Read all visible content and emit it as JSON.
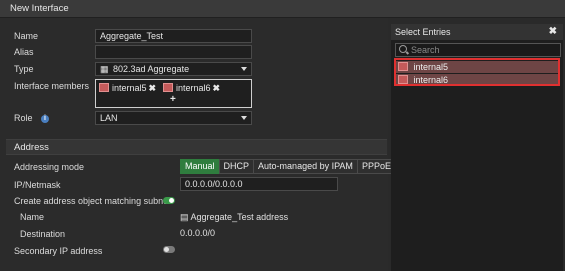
{
  "window": {
    "title": "New Interface"
  },
  "form": {
    "name": {
      "label": "Name",
      "value": "Aggregate_Test"
    },
    "alias": {
      "label": "Alias",
      "value": ""
    },
    "type": {
      "label": "Type",
      "value": "802.3ad Aggregate"
    },
    "members": {
      "label": "Interface members",
      "items": [
        "internal5",
        "internal6"
      ],
      "add_glyph": "+"
    },
    "role": {
      "label": "Role",
      "value": "LAN"
    }
  },
  "address": {
    "section_title": "Address",
    "mode_label": "Addressing mode",
    "modes": [
      "Manual",
      "DHCP",
      "Auto-managed by IPAM",
      "PPPoE"
    ],
    "selected_mode": "Manual",
    "ip_label": "IP/Netmask",
    "ip_value": "0.0.0.0/0.0.0.0",
    "create_obj_label": "Create address object matching subnet",
    "create_obj_enabled": true,
    "obj_name_label": "Name",
    "obj_name_value": "Aggregate_Test address",
    "destination_label": "Destination",
    "destination_value": "0.0.0.0/0",
    "secondary_label": "Secondary IP address",
    "secondary_enabled": false
  },
  "select_panel": {
    "title": "Select Entries",
    "search_placeholder": "Search",
    "entries": [
      "internal5",
      "internal6"
    ]
  },
  "colors": {
    "accent_green": "#2f7d3e",
    "highlight_red": "#e03030",
    "toggle_on": "#3a9a4a"
  }
}
